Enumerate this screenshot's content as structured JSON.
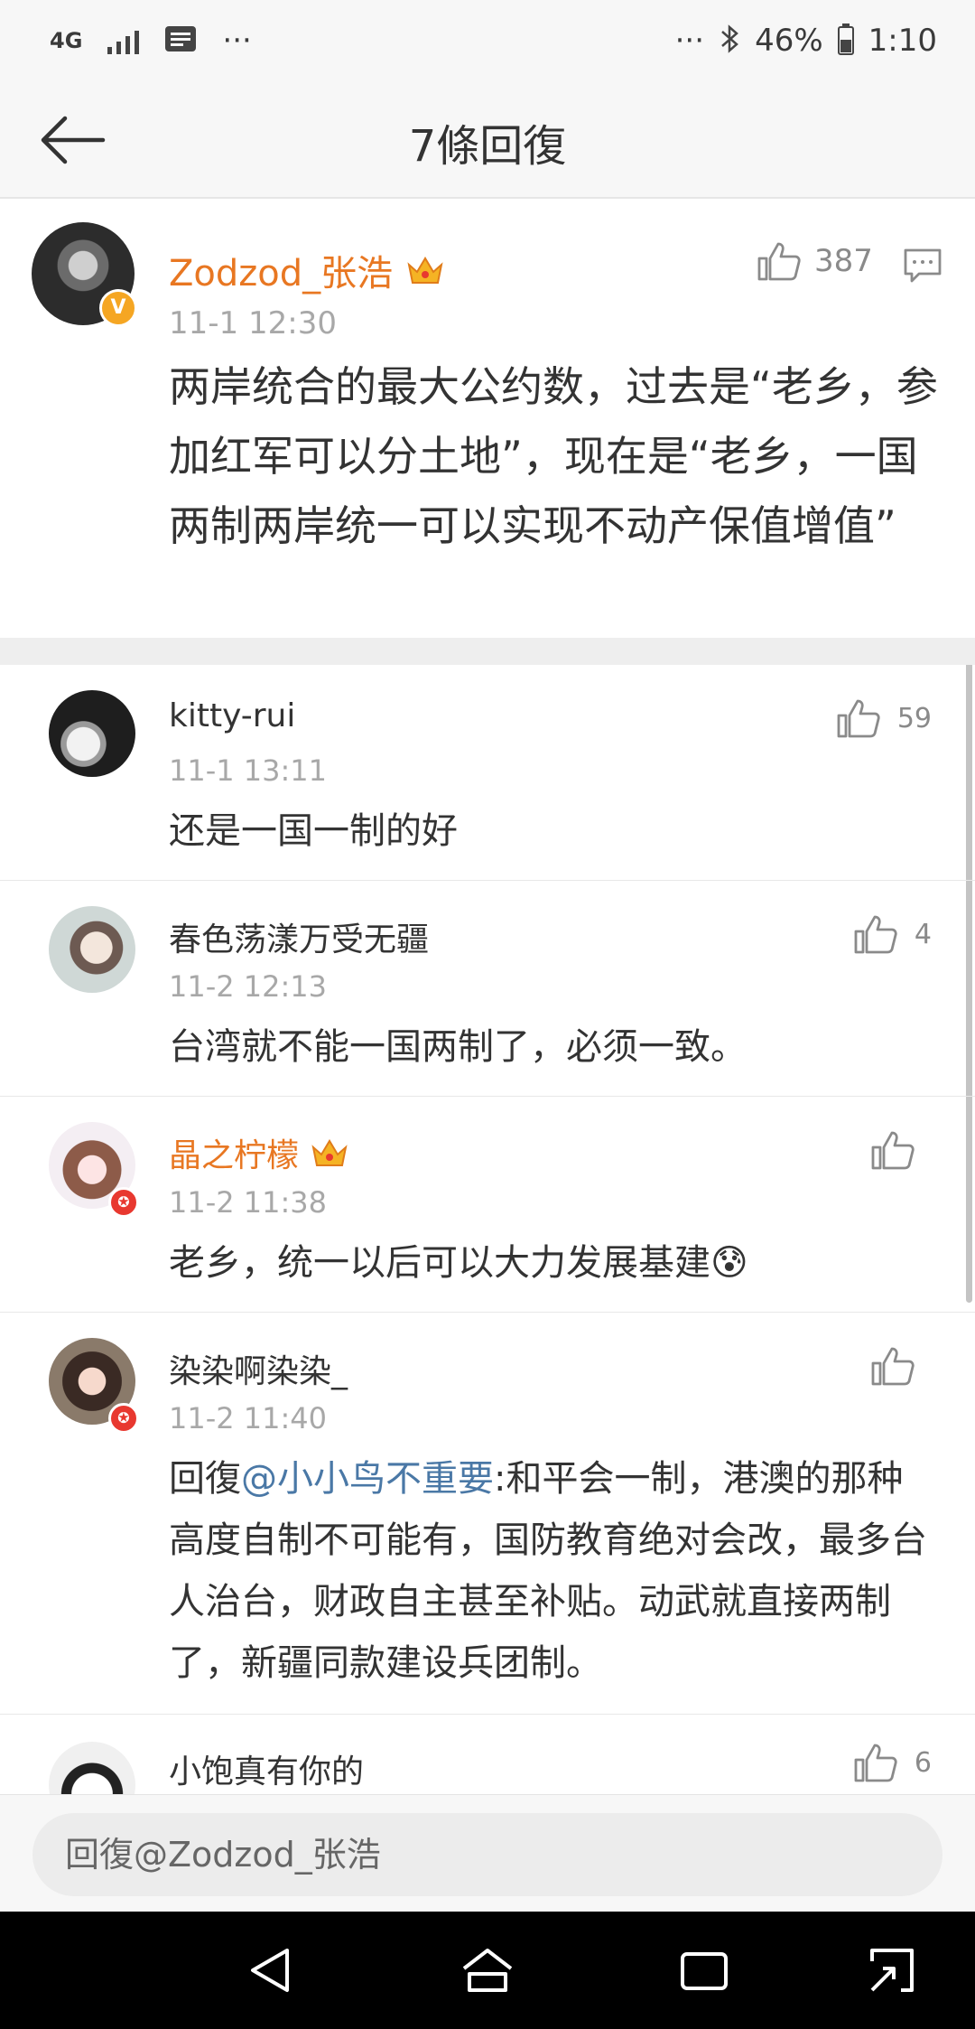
{
  "status_bar": {
    "network": "4G",
    "extra": "···",
    "extra_right": "···",
    "battery": "46%",
    "time": "1:10"
  },
  "header": {
    "title": "7條回復"
  },
  "main_comment": {
    "author": "Zodzod_张浩",
    "verified_badge": "V",
    "time": "11-1 12:30",
    "likes": "387",
    "text": "两岸统合的最大公约数，过去是“老乡，参加红军可以分土地”，现在是“老乡，一国两制两岸统一可以实现不动产保值增值”"
  },
  "replies": [
    {
      "author": "kitty-rui",
      "time": "11-1 13:11",
      "likes": "59",
      "text": "还是一国一制的好"
    },
    {
      "author": "春色荡漾万受无疆",
      "time": "11-2 12:13",
      "likes": "4",
      "text": "台湾就不能一国两制了，必须一致。"
    },
    {
      "author": "晶之柠檬",
      "time": "11-2 11:38",
      "likes": "",
      "text": "老乡，统一以后可以大力发展基建😰"
    },
    {
      "author": "染染啊染染_",
      "time": "11-2 11:40",
      "likes": "",
      "reply_prefix": "回復",
      "mention": "@小小鸟不重要",
      "text": ":和平会一制，港澳的那种高度自制不可能有，国防教育绝对会改，最多台人治台，财政自主甚至补贴。动武就直接两制了，新疆同款建设兵团制。"
    },
    {
      "author": "小饱真有你的",
      "time": "",
      "likes": "6",
      "text": ""
    }
  ],
  "reply_input": {
    "placeholder": "回復@Zodzod_张浩"
  },
  "colors": {
    "vip_name": "#e87722",
    "mention": "#4a78a6",
    "muted": "#a8a8a8",
    "badge_red": "#e8382f",
    "badge_gold": "#f5a623"
  },
  "icons": [
    "back-arrow-icon",
    "thumbs-up-icon",
    "comment-icon",
    "crown-icon",
    "nav-back-icon",
    "nav-home-icon",
    "nav-recents-icon",
    "nav-rotate-icon"
  ]
}
